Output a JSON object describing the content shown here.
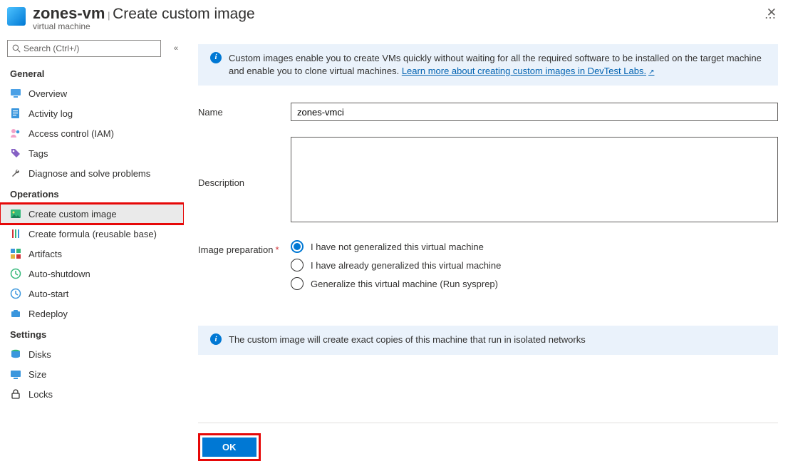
{
  "header": {
    "resource_name": "zones-vm",
    "separator": "|",
    "page_title": "Create custom image",
    "subtitle": "virtual machine"
  },
  "search": {
    "placeholder": "Search (Ctrl+/)"
  },
  "sidebar": {
    "groups": [
      {
        "title": "General",
        "items": [
          {
            "id": "overview",
            "label": "Overview",
            "icon": "monitor-icon"
          },
          {
            "id": "activity",
            "label": "Activity log",
            "icon": "log-icon"
          },
          {
            "id": "iam",
            "label": "Access control (IAM)",
            "icon": "people-icon"
          },
          {
            "id": "tags",
            "label": "Tags",
            "icon": "tag-icon"
          },
          {
            "id": "diagnose",
            "label": "Diagnose and solve problems",
            "icon": "wrench-icon"
          }
        ]
      },
      {
        "title": "Operations",
        "items": [
          {
            "id": "create-image",
            "label": "Create custom image",
            "icon": "image-icon",
            "selected": true,
            "highlighted": true
          },
          {
            "id": "create-formula",
            "label": "Create formula (reusable base)",
            "icon": "flask-icon"
          },
          {
            "id": "artifacts",
            "label": "Artifacts",
            "icon": "grid-icon"
          },
          {
            "id": "auto-shutdown",
            "label": "Auto-shutdown",
            "icon": "clock-icon"
          },
          {
            "id": "auto-start",
            "label": "Auto-start",
            "icon": "clock-on-icon"
          },
          {
            "id": "redeploy",
            "label": "Redeploy",
            "icon": "briefcase-icon"
          }
        ]
      },
      {
        "title": "Settings",
        "items": [
          {
            "id": "disks",
            "label": "Disks",
            "icon": "disks-icon"
          },
          {
            "id": "size",
            "label": "Size",
            "icon": "size-icon"
          },
          {
            "id": "locks",
            "label": "Locks",
            "icon": "lock-icon"
          }
        ]
      }
    ]
  },
  "main": {
    "banner1_text": "Custom images enable you to create VMs quickly without waiting for all the required software to be installed on the target machine and enable you to clone virtual machines. ",
    "banner1_link": "Learn more about creating custom images in DevTest Labs.",
    "name_label": "Name",
    "name_value": "zones-vmci",
    "desc_label": "Description",
    "desc_value": "",
    "prep_label": "Image preparation",
    "radios": [
      {
        "label": "I have not generalized this virtual machine",
        "selected": true
      },
      {
        "label": "I have already generalized this virtual machine",
        "selected": false
      },
      {
        "label": "Generalize this virtual machine (Run sysprep)",
        "selected": false
      }
    ],
    "banner2_text": "The custom image will create exact copies of this machine that run in isolated networks"
  },
  "footer": {
    "ok_label": "OK"
  }
}
